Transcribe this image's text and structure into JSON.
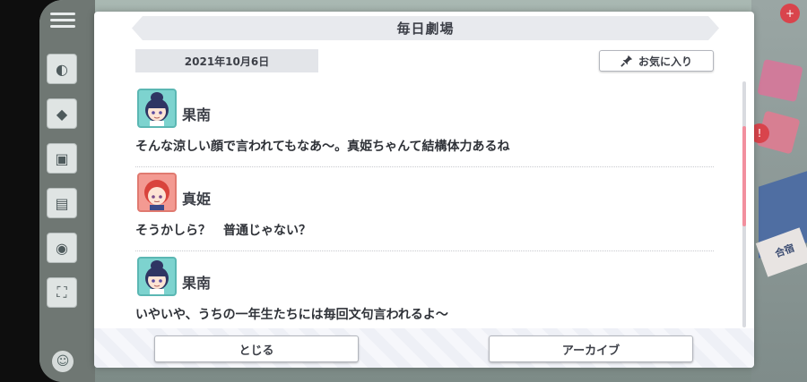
{
  "modal": {
    "title": "毎日劇場",
    "date": "2021年10月6日",
    "favorite_label": "お気に入り"
  },
  "dialogue": [
    {
      "speaker": "果南",
      "avatar": "kanan-avatar",
      "line": "そんな涼しい顔で言われてもなあ〜。真姫ちゃんて結構体力あるね"
    },
    {
      "speaker": "真姫",
      "avatar": "maki-avatar",
      "line": "そうかしら？　普通じゃない？"
    },
    {
      "speaker": "果南",
      "avatar": "kanan-avatar",
      "line": "いやいや、うちの一年生たちには毎回文句言われるよ〜"
    }
  ],
  "buttons": {
    "close_label": "とじる",
    "archive_label": "アーカイブ"
  },
  "background": {
    "tab_label": "合宿",
    "badge": "+",
    "alert": "!"
  },
  "colors": {
    "scrollbar_thumb": "#f28f9e",
    "kanan_frame": "#7dd3cf",
    "maki_frame": "#f39a92"
  },
  "icons": [
    "menu-icon",
    "pin-icon",
    "back-icon",
    "settings-icon"
  ]
}
